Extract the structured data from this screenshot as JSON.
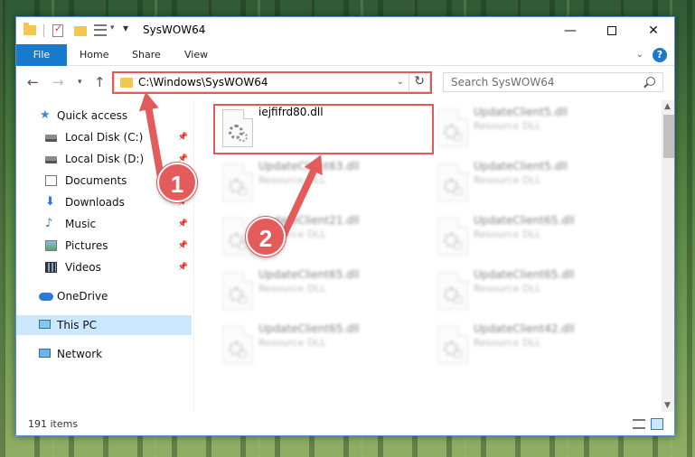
{
  "window": {
    "title": "SysWOW64"
  },
  "ribbon": {
    "tabs": [
      "File",
      "Home",
      "Share",
      "View"
    ]
  },
  "address_bar": {
    "path": "C:\\Windows\\SysWOW64"
  },
  "search": {
    "placeholder": "Search SysWOW64"
  },
  "sidebar": {
    "items": [
      {
        "label": "Quick access",
        "icon": "star-icon"
      },
      {
        "label": "Local Disk (C:)",
        "icon": "drive-icon",
        "pinned": true
      },
      {
        "label": "Local Disk (D:)",
        "icon": "drive-icon",
        "pinned": true
      },
      {
        "label": "Documents",
        "icon": "documents-icon",
        "pinned": true
      },
      {
        "label": "Downloads",
        "icon": "download-icon",
        "pinned": true
      },
      {
        "label": "Music",
        "icon": "music-icon",
        "pinned": true
      },
      {
        "label": "Pictures",
        "icon": "pictures-icon",
        "pinned": true
      },
      {
        "label": "Videos",
        "icon": "videos-icon",
        "pinned": true
      },
      {
        "label": "OneDrive",
        "icon": "cloud-icon"
      },
      {
        "label": "This PC",
        "icon": "computer-icon",
        "selected": true
      },
      {
        "label": "Network",
        "icon": "network-icon"
      }
    ]
  },
  "files": [
    {
      "name": "iejfifrd80.dll",
      "type": ""
    },
    {
      "name": "UpdateClient5.dll",
      "type": "Resource DLL"
    },
    {
      "name": "UpdateClient63.dll",
      "type": "Resource DLL"
    },
    {
      "name": "UpdateClient5.dll",
      "type": "Resource DLL"
    },
    {
      "name": "UpdateClient21.dll",
      "type": "Resource DLL"
    },
    {
      "name": "UpdateClient65.dll",
      "type": "Resource DLL"
    },
    {
      "name": "UpdateClient65.dll",
      "type": "Resource DLL"
    },
    {
      "name": "UpdateClient65.dll",
      "type": "Resource DLL"
    },
    {
      "name": "UpdateClient65.dll",
      "type": "Resource DLL"
    },
    {
      "name": "UpdateClient42.dll",
      "type": "Resource DLL"
    }
  ],
  "status_bar": {
    "item_count": "191 items"
  },
  "annotations": {
    "step1": "1",
    "step2": "2",
    "color": "#e35b5b"
  },
  "window_controls": {
    "minimize": "—",
    "close": "✕"
  }
}
